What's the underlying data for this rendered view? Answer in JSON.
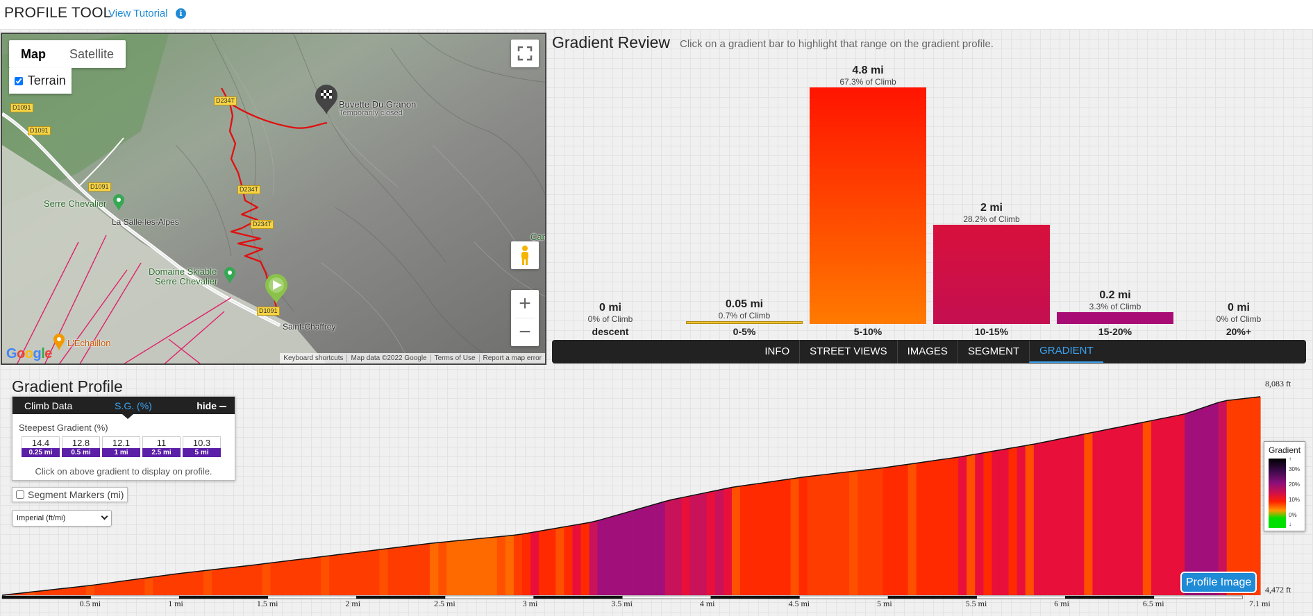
{
  "header": {
    "title": "PROFILE TOOL",
    "tutorial_link": "View Tutorial",
    "info_icon": "i"
  },
  "map": {
    "map_type_buttons": [
      "Map",
      "Satellite"
    ],
    "terrain_label": "Terrain",
    "terrain_checked": true,
    "labels": {
      "buvette": "Buvette Du Granon",
      "buvette_status": "Temporarily closed",
      "serre_chevalier": "Serre Chevalier",
      "la_salle": "La Salle-les-Alpes",
      "domaine_line1": "Domaine Skiable",
      "domaine_line2": "Serre Chevalier",
      "saint_chaffrey": "Saint-Chaffrey",
      "echaillon": "L'Echaillon",
      "cam": "Cam"
    },
    "road_tags": [
      "D1091",
      "D1091",
      "D234T",
      "D1091",
      "D234T",
      "D234T",
      "D1091"
    ],
    "attribution": [
      "Keyboard shortcuts",
      "Map data ©2022 Google",
      "Terms of Use",
      "Report a map error"
    ],
    "logo": "Google",
    "zoom_in": "+",
    "zoom_out": "−"
  },
  "gradient_review": {
    "title": "Gradient Review",
    "subtitle": "Click on a gradient bar to highlight that range on the gradient profile.",
    "bars": [
      {
        "category": "descent",
        "distance": "0 mi",
        "percent": "0% of Climb",
        "pct_value": 0,
        "color": "#cccccc"
      },
      {
        "category": "0-5%",
        "distance": "0.05 mi",
        "percent": "0.7% of Climb",
        "pct_value": 0.7,
        "color": "#f2c230"
      },
      {
        "category": "5-10%",
        "distance": "4.8 mi",
        "percent": "67.3% of Climb",
        "pct_value": 67.3,
        "color": "#ff3300"
      },
      {
        "category": "10-15%",
        "distance": "2 mi",
        "percent": "28.2% of Climb",
        "pct_value": 28.2,
        "color": "#d8103c"
      },
      {
        "category": "15-20%",
        "distance": "0.2 mi",
        "percent": "3.3% of Climb",
        "pct_value": 3.3,
        "color": "#a80c74"
      },
      {
        "category": "20%+",
        "distance": "0 mi",
        "percent": "0% of Climb",
        "pct_value": 0,
        "color": "#333333"
      }
    ]
  },
  "tabs": [
    {
      "label": "INFO",
      "active": false
    },
    {
      "label": "STREET VIEWS",
      "active": false
    },
    {
      "label": "IMAGES",
      "active": false
    },
    {
      "label": "SEGMENT",
      "active": false
    },
    {
      "label": "GRADIENT",
      "active": true
    }
  ],
  "profile": {
    "title": "Gradient Profile",
    "climb_panel": {
      "tab_climb_data": "Climb Data",
      "tab_sg": "S.G. (%)",
      "hide_label": "hide",
      "steepest_label": "Steepest Gradient (%)",
      "cells": [
        {
          "value": "14.4",
          "distance": "0.25 mi"
        },
        {
          "value": "12.8",
          "distance": "0.5 mi"
        },
        {
          "value": "12.1",
          "distance": "1 mi"
        },
        {
          "value": "11",
          "distance": "2.5 mi"
        },
        {
          "value": "10.3",
          "distance": "5 mi"
        }
      ],
      "hint": "Click on above gradient to display on profile."
    },
    "segment_markers_label": "Segment Markers (mi)",
    "segment_markers_checked": false,
    "units_selected": "Imperial (ft/mi)",
    "legend": {
      "title": "Gradient",
      "ticks": [
        "30%",
        "20%",
        "10%",
        "0%"
      ]
    },
    "profile_image_button": "Profile Image",
    "elevation_max": "8,083 ft",
    "elevation_min": "4,472 ft",
    "mile_labels": [
      "0.5 mi",
      "1 mi",
      "1.5 mi",
      "2 mi",
      "2.5 mi",
      "3 mi",
      "3.5 mi",
      "4 mi",
      "4.5 mi",
      "5 mi",
      "5.5 mi",
      "6 mi",
      "6.5 mi",
      "7.1 mi"
    ]
  }
}
